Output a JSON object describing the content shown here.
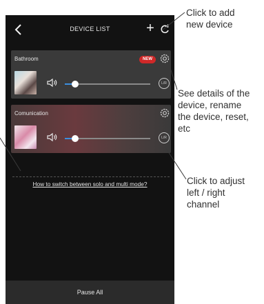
{
  "header": {
    "back_icon": "chevron-left-icon",
    "title": "DEVICE LIST",
    "add_label": "+",
    "refresh_icon": "refresh-icon"
  },
  "devices": [
    {
      "name": "Bathroom",
      "badge": "NEW",
      "lr_label": "L/R",
      "volume": 0.12
    },
    {
      "name": "Comunication",
      "badge": "",
      "lr_label": "L/R",
      "volume": 0.12
    }
  ],
  "help_link": "How to switch between solo and multi mode?",
  "footer": {
    "pause_all": "Pause All"
  },
  "callouts": {
    "add": "Click to add\nnew device",
    "details": "See details of the\ndevice, rename\nthe device, reset,\netc",
    "channel": "Click to adjust\nleft / right\nchannel"
  },
  "colors": {
    "accent": "#3b8fe0",
    "badge": "#d02828",
    "background": "#121212"
  }
}
